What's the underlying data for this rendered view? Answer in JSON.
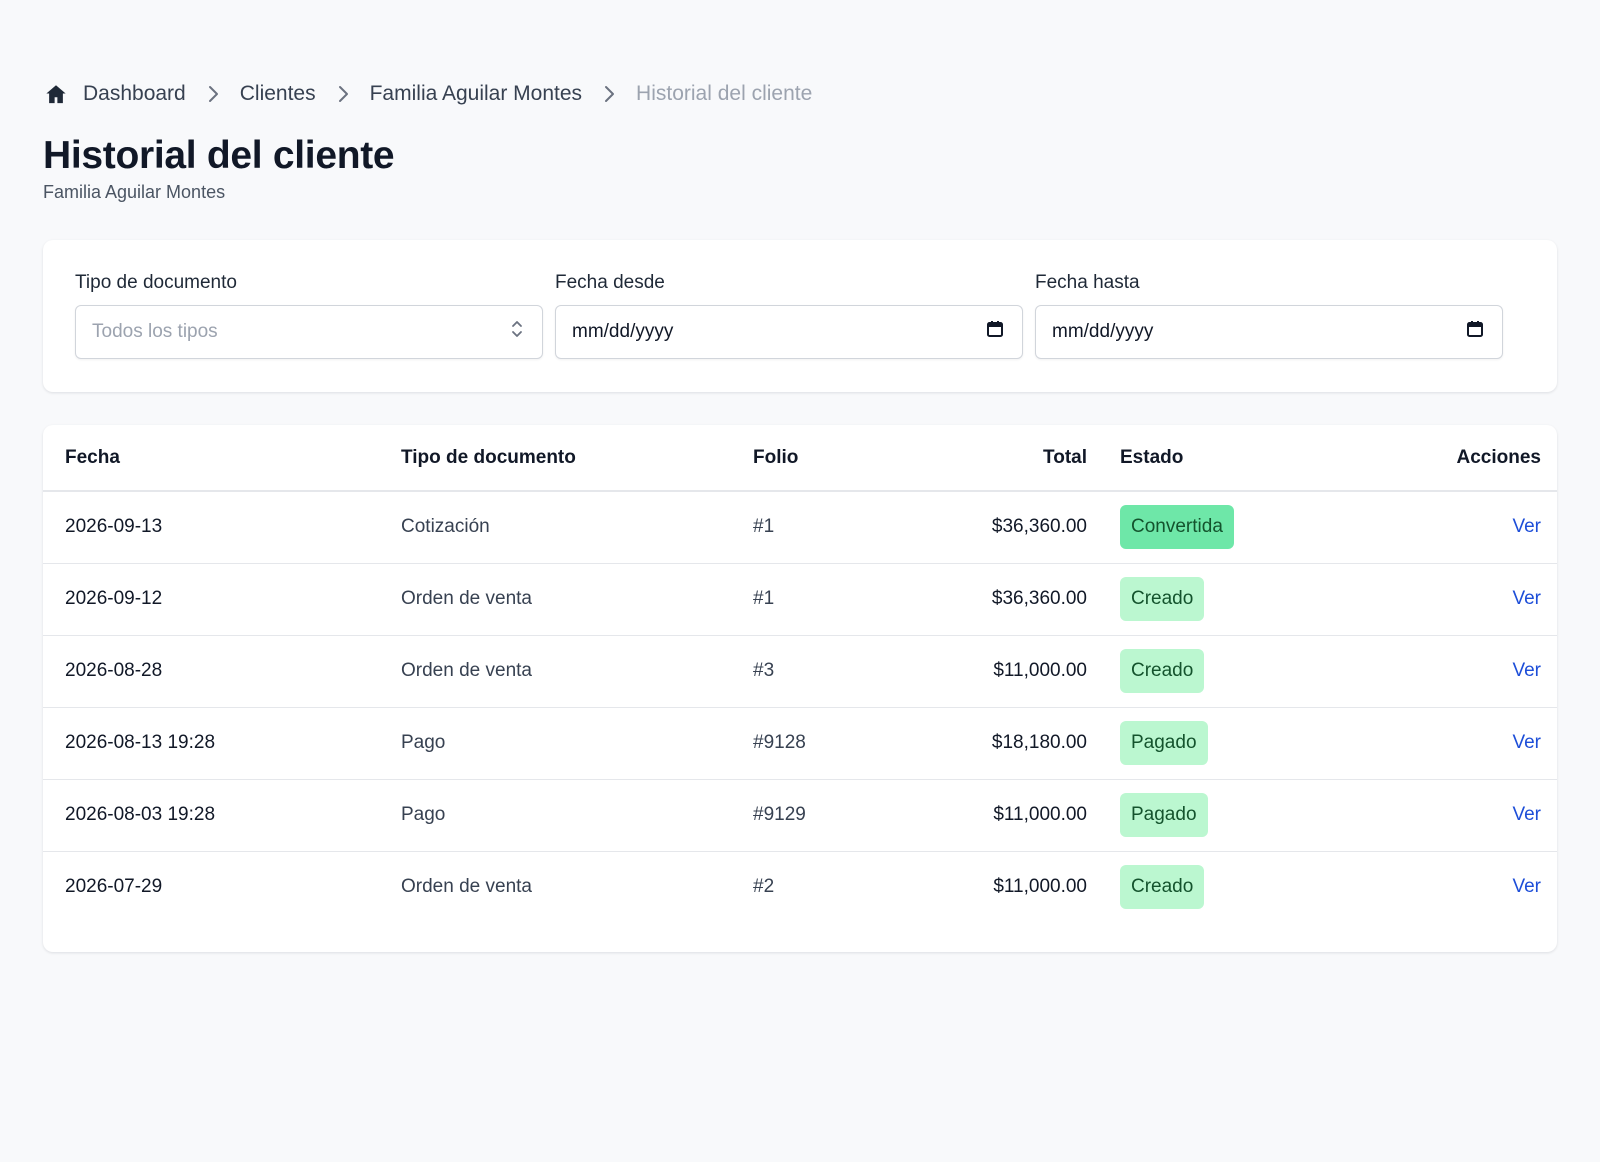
{
  "breadcrumb": {
    "items": [
      {
        "label": "Dashboard"
      },
      {
        "label": "Clientes"
      },
      {
        "label": "Familia Aguilar Montes"
      },
      {
        "label": "Historial del cliente"
      }
    ]
  },
  "header": {
    "title": "Historial del cliente",
    "subtitle": "Familia Aguilar Montes"
  },
  "filters": {
    "doc_type": {
      "label": "Tipo de documento",
      "placeholder": "Todos los tipos"
    },
    "date_from": {
      "label": "Fecha desde",
      "value": "mm/dd/yyyy"
    },
    "date_to": {
      "label": "Fecha hasta",
      "value": "mm/dd/yyyy"
    }
  },
  "table": {
    "columns": [
      "Fecha",
      "Tipo de documento",
      "Folio",
      "Total",
      "Estado",
      "Acciones"
    ],
    "rows": [
      {
        "fecha": "2026-09-13",
        "tipo": "Cotización",
        "folio": "#1",
        "total": "$36,360.00",
        "estado": "Convertida",
        "accion": "Ver"
      },
      {
        "fecha": "2026-09-12",
        "tipo": "Orden de venta",
        "folio": "#1",
        "total": "$36,360.00",
        "estado": "Creado",
        "accion": "Ver"
      },
      {
        "fecha": "2026-08-28",
        "tipo": "Orden de venta",
        "folio": "#3",
        "total": "$11,000.00",
        "estado": "Creado",
        "accion": "Ver"
      },
      {
        "fecha": "2026-08-13 19:28",
        "tipo": "Pago",
        "folio": "#9128",
        "total": "$18,180.00",
        "estado": "Pagado",
        "accion": "Ver"
      },
      {
        "fecha": "2026-08-03 19:28",
        "tipo": "Pago",
        "folio": "#9129",
        "total": "$11,000.00",
        "estado": "Pagado",
        "accion": "Ver"
      },
      {
        "fecha": "2026-07-29",
        "tipo": "Orden de venta",
        "folio": "#2",
        "total": "$11,000.00",
        "estado": "Creado",
        "accion": "Ver"
      }
    ]
  },
  "colors": {
    "badge_converted": "#6ee7a8",
    "badge_created": "#bbf7d0",
    "badge_paid": "#bbf7d0",
    "link": "#1d4ed8"
  },
  "icons": [
    "home-icon",
    "chevron-right-icon",
    "select-updown-icon",
    "calendar-icon"
  ]
}
